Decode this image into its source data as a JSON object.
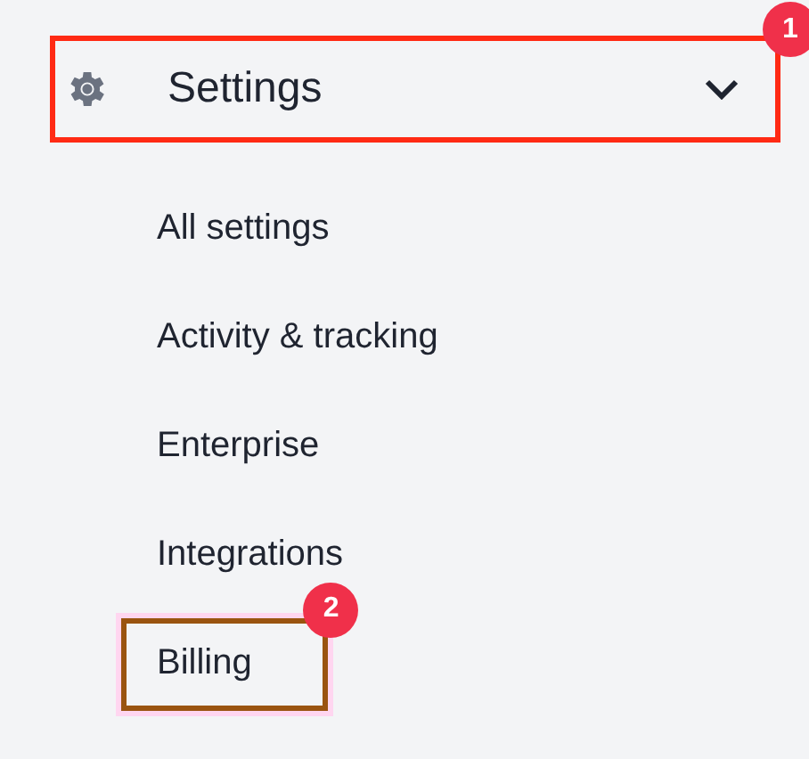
{
  "section": {
    "label": "Settings",
    "expanded": true,
    "callout": "1"
  },
  "items": [
    {
      "label": "All settings",
      "highlighted": false
    },
    {
      "label": "Activity & tracking",
      "highlighted": false
    },
    {
      "label": "Enterprise",
      "highlighted": false
    },
    {
      "label": "Integrations",
      "highlighted": false
    },
    {
      "label": "Billing",
      "highlighted": true,
      "callout": "2"
    }
  ]
}
